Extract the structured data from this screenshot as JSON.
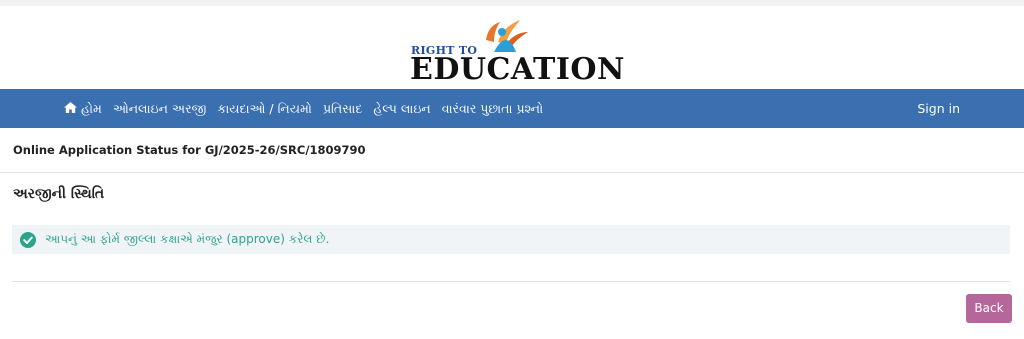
{
  "logo": {
    "line1": "RIGHT TO",
    "line2": "EDUCATION"
  },
  "nav": {
    "items": [
      {
        "label": "હોમ",
        "icon": "home-icon"
      },
      {
        "label": "ઓનલાઇન અરજી"
      },
      {
        "label": "કાયદાઓ / નિયમો"
      },
      {
        "label": "પ્રતિસાદ"
      },
      {
        "label": "હેલ્પ લાઇન"
      },
      {
        "label": "વારંવાર પુછાતા પ્રશ્નો"
      }
    ],
    "sign_in": "Sign in"
  },
  "status": {
    "heading": "Online Application Status for GJ/2025-26/SRC/1809790"
  },
  "section": {
    "title": "અરજીની સ્થિતિ"
  },
  "alert": {
    "message": "આપનું આ ફોર્મ જીલ્લા કક્ષાએ મંજુર (approve) કરેલ છે.",
    "icon": "check-circle-icon"
  },
  "actions": {
    "back_label": "Back"
  },
  "colors": {
    "navbar": "#3a6fb0",
    "success": "#2aa58b",
    "back_button": "#b5679b"
  }
}
